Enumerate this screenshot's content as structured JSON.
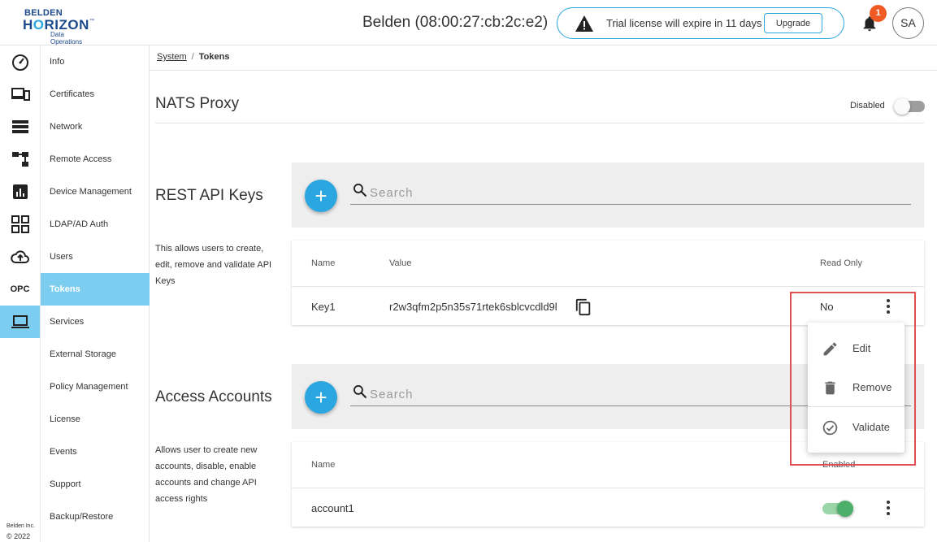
{
  "brand": {
    "line1": "BELDEN",
    "line2a": "H",
    "line2b": "RIZON",
    "tm": "™",
    "line3": "Data Operations"
  },
  "header": {
    "device_title": "Belden (08:00:27:cb:2c:e2)",
    "trial_message": "Trial license will expire in 11 days",
    "upgrade_label": "Upgrade",
    "notification_count": "1",
    "avatar_initials": "SA"
  },
  "rail": {
    "icons": [
      "dashboard-icon",
      "devices-icon",
      "list-icon",
      "hierarchy-icon",
      "analytics-icon",
      "apps-icon",
      "cloud-upload-icon",
      "opc-icon",
      "laptop-icon"
    ],
    "opc_label": "OPC",
    "active_index": 8
  },
  "footer": {
    "company": "Belden Inc.",
    "year": "© 2022"
  },
  "subnav": {
    "items": [
      "Info",
      "Certificates",
      "Network",
      "Remote Access",
      "Device Management",
      "LDAP/AD Auth",
      "Users",
      "Tokens",
      "Services",
      "External Storage",
      "Policy Management",
      "License",
      "Events",
      "Support",
      "Backup/Restore"
    ],
    "active_index": 7
  },
  "breadcrumb": {
    "parent": "System",
    "separator": "/",
    "current": "Tokens"
  },
  "nats": {
    "title": "NATS Proxy",
    "status_label": "Disabled",
    "enabled": false
  },
  "api_keys": {
    "title": "REST API Keys",
    "description": "This allows users to create, edit, remove and validate API Keys",
    "search_placeholder": "Search",
    "add_label": "+",
    "columns": {
      "name": "Name",
      "value": "Value",
      "read_only": "Read Only"
    },
    "rows": [
      {
        "name": "Key1",
        "value": "r2w3qfm2p5n35s71rtek6sblcvcdld9l",
        "read_only": "No"
      }
    ]
  },
  "accounts": {
    "title": "Access Accounts",
    "description": "Allows user to create new accounts, disable, enable accounts and change API access rights",
    "search_placeholder": "Search",
    "add_label": "+",
    "columns": {
      "name": "Name",
      "enabled": "Enabled"
    },
    "rows": [
      {
        "name": "account1",
        "enabled": true
      }
    ]
  },
  "context_menu": {
    "items": [
      {
        "label": "Edit",
        "icon": "pencil-icon"
      },
      {
        "label": "Remove",
        "icon": "trash-icon"
      },
      {
        "label": "Validate",
        "icon": "check-circle-icon"
      }
    ]
  },
  "colors": {
    "accent": "#2aa6e0",
    "active_nav": "#7dcdf0",
    "badge": "#f05a24",
    "highlight": "#e05050",
    "toggle_on": "#4caf6a"
  }
}
